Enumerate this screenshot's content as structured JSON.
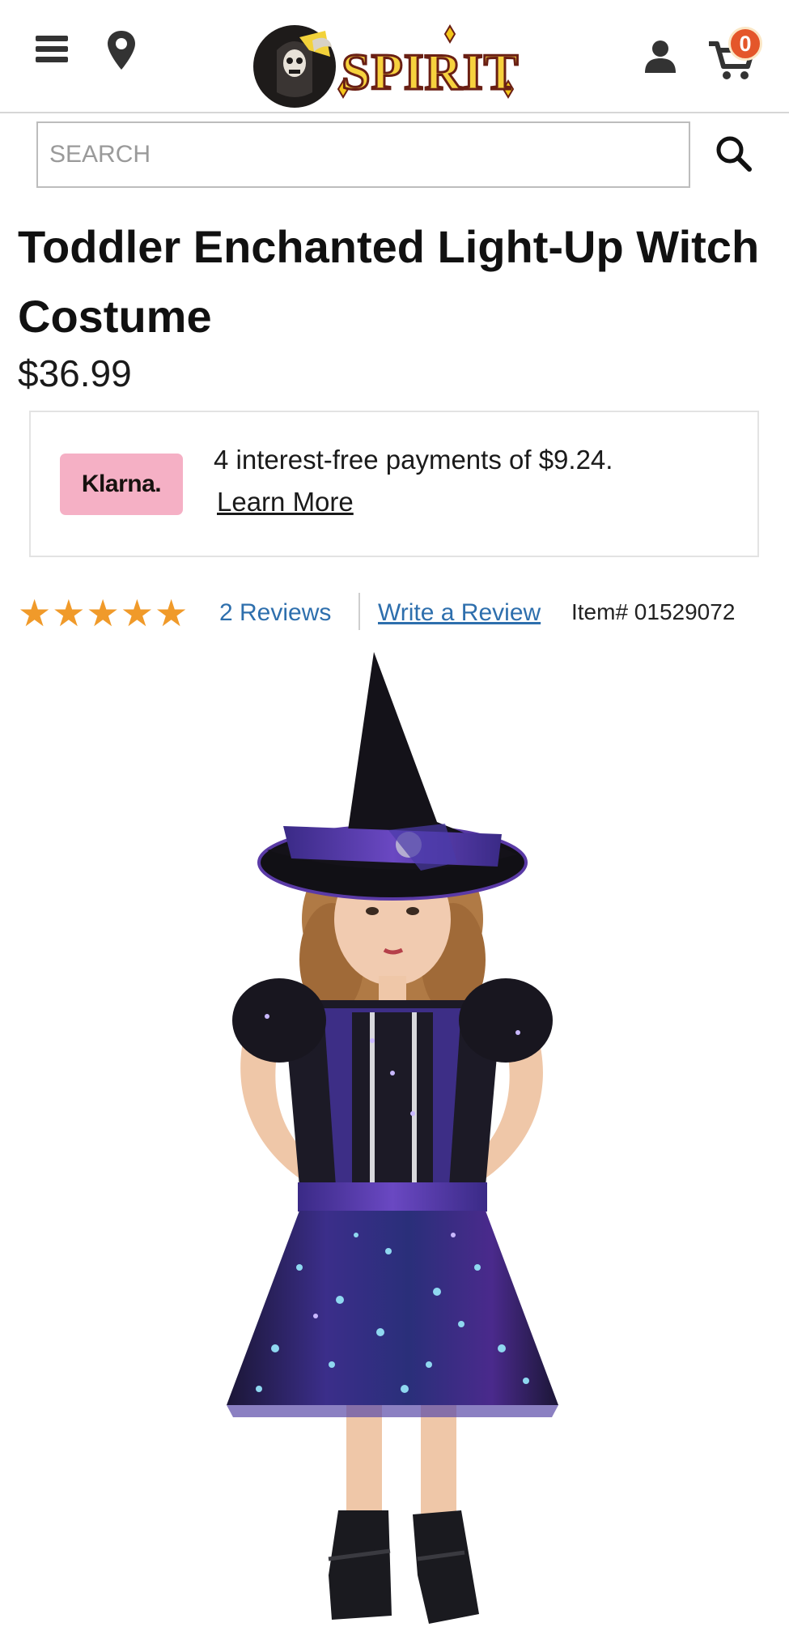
{
  "header": {
    "logo_text": "SPIRIT",
    "cart_count": "0",
    "icons": [
      "menu-icon",
      "location-pin-icon",
      "user-icon",
      "cart-icon",
      "search-icon"
    ]
  },
  "search": {
    "placeholder": "SEARCH",
    "value": ""
  },
  "product": {
    "title": "Toddler Enchanted Light-Up Witch Costume",
    "price": "$36.99",
    "klarna": {
      "badge": "Klarna.",
      "message": "4 interest-free payments of $9.24.",
      "link": "Learn More"
    },
    "rating": {
      "stars": "★★★★★",
      "value": 5,
      "max": 5,
      "reviews_link": "2 Reviews",
      "write_review": "Write a Review",
      "item_number": "Item# 01529072"
    }
  },
  "colors": {
    "accent_link": "#2e6fad",
    "star": "#f09a2a",
    "cart_badge": "#e4562a",
    "klarna_pink": "#f5b0c5"
  }
}
